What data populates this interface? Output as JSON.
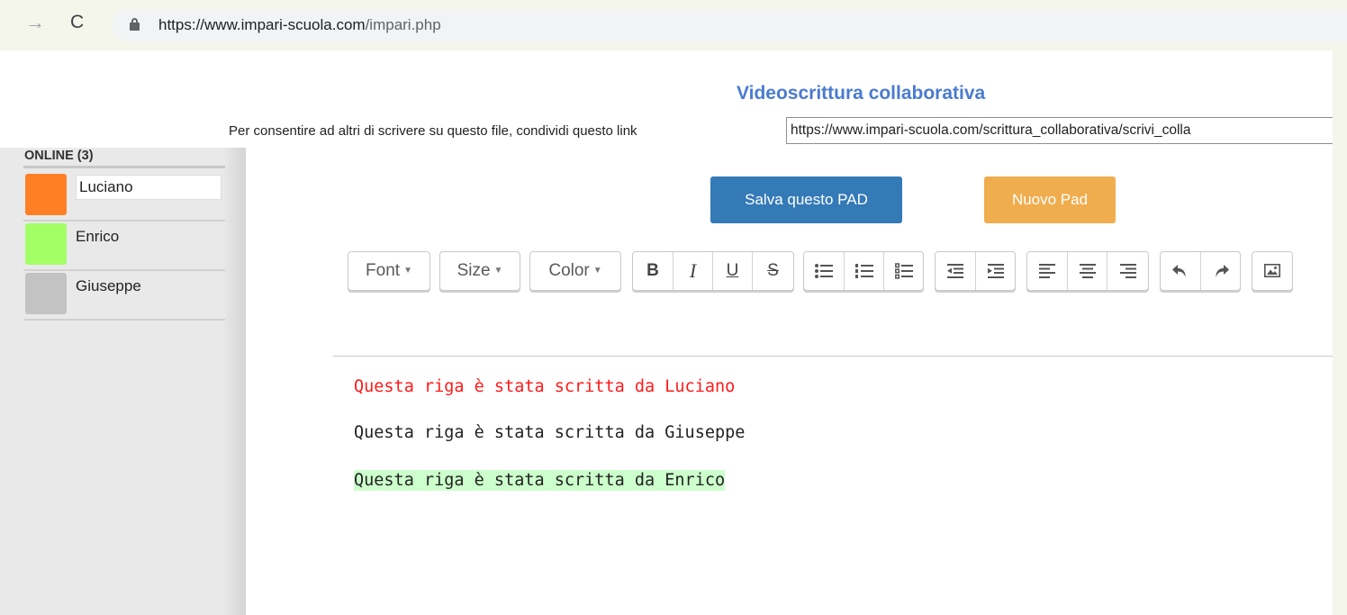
{
  "browser": {
    "url_domain": "https://www.impari-scuola.com",
    "url_path": "/impari.php"
  },
  "app": {
    "title": "Videoscrittura collaborativa",
    "share_label": "Per consentire ad altri di scrivere su questo file, condividi questo link",
    "share_link": "https://www.impari-scuola.com/scrittura_collaborativa/scrivi_colla"
  },
  "sidebar": {
    "online_title": "ONLINE (3)",
    "users": [
      {
        "name": "Luciano",
        "color": "#ff7f27",
        "editable": true
      },
      {
        "name": "Enrico",
        "color": "#a2ff66",
        "editable": false
      },
      {
        "name": "Giuseppe",
        "color": "#c3c3c3",
        "editable": false
      }
    ]
  },
  "buttons": {
    "save": "Salva questo PAD",
    "new": "Nuovo Pad"
  },
  "toolbar": {
    "font": "Font",
    "size": "Size",
    "color": "Color",
    "bold": "B",
    "italic": "I",
    "underline": "U",
    "strike": "S"
  },
  "editor": {
    "lines": [
      {
        "text": "Questa riga è stata scritta da Luciano",
        "color": "#ff1a1a"
      },
      {
        "text": "Questa riga è stata scritta da Giuseppe",
        "color": "#222222"
      },
      {
        "text": "Questa riga è stata scritta da Enrico",
        "highlight": "#ccffcc"
      }
    ]
  },
  "colors": {
    "title": "#4a7bd0",
    "save_button": "#347ab7",
    "new_button": "#f0ad4e"
  }
}
